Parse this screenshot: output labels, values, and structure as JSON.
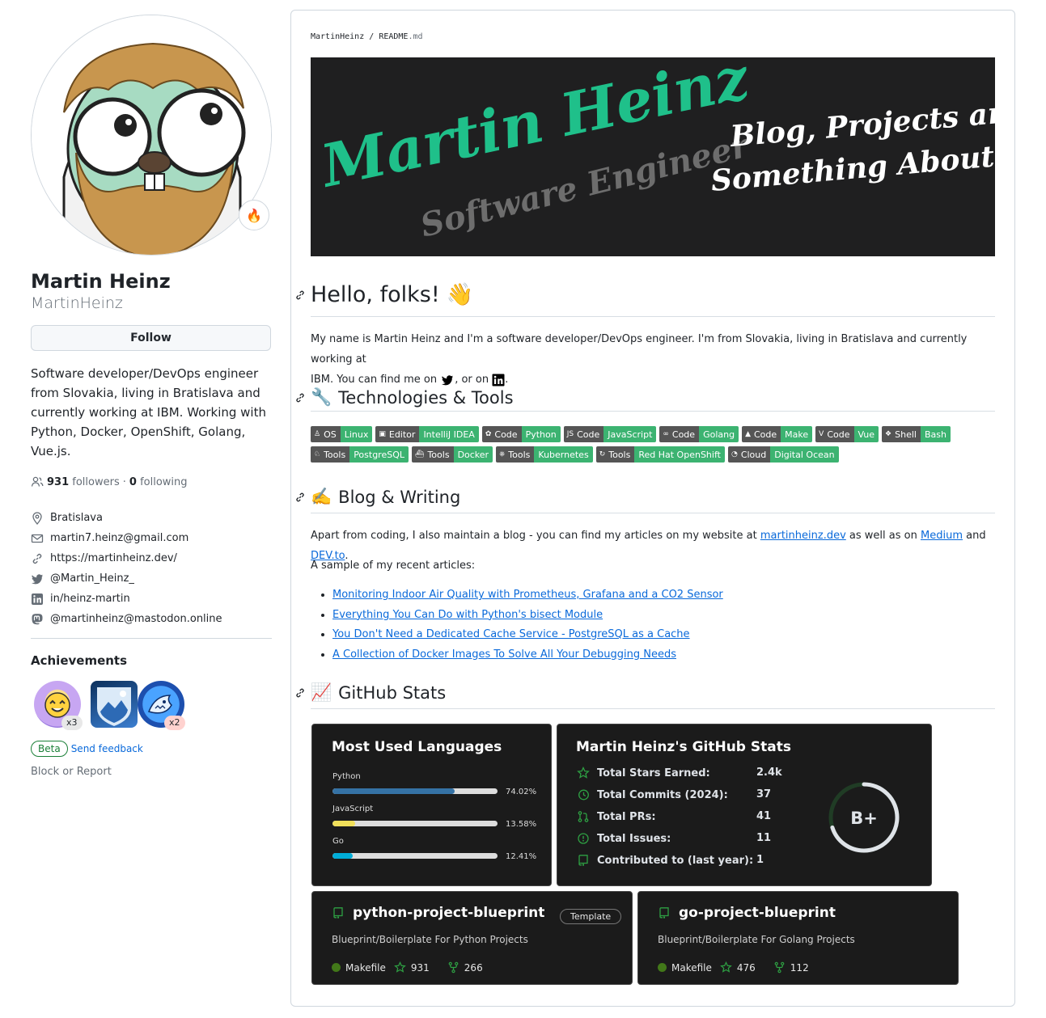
{
  "profile": {
    "fullname": "Martin Heinz",
    "username": "MartinHeinz",
    "follow_label": "Follow",
    "status_emoji": "🔥",
    "bio": "Software developer/DevOps engineer from Slovakia, living in Bratislava and currently working at IBM. Working with Python, Docker, OpenShift, Golang, Vue.js.",
    "followers_count": "931",
    "followers_label": "followers",
    "separator": "·",
    "following_count": "0",
    "following_label": "following",
    "location": "Bratislava",
    "email": "martin7.heinz@gmail.com",
    "website": "https://martinheinz.dev/",
    "twitter": "@Martin_Heinz_",
    "linkedin": "in/heinz-martin",
    "mastodon": "@martinheinz@mastodon.online",
    "achievements_title": "Achievements",
    "achievements": [
      {
        "name": "starstruck-badge",
        "count": "x3"
      },
      {
        "name": "arctic-code-vault-badge",
        "count": ""
      },
      {
        "name": "pull-shark-badge",
        "count": "x2"
      }
    ],
    "beta_label": "Beta",
    "feedback_label": "Send feedback",
    "block_label": "Block or Report"
  },
  "readme": {
    "crumb_user": "MartinHeinz",
    "crumb_sep": "/",
    "crumb_file": "README",
    "crumb_ext": ".md",
    "banner": {
      "name": "Martin Heinz",
      "role": "Software Engineer",
      "tagline_1": "Blog, Projects and",
      "tagline_2": "Something About Me"
    },
    "hello_heading": "Hello, folks!",
    "hello_emoji": "👋",
    "intro_1": "My name is Martin Heinz and I'm a software developer/DevOps engineer. I'm from Slovakia, living in Bratislava and currently working at",
    "intro_2a": "IBM. You can find me on",
    "intro_2b": ", or on",
    "intro_2c": ".",
    "tech_heading": "Technologies & Tools",
    "tech_emoji": "🔧",
    "shields": [
      {
        "label": "OS",
        "value": "Linux"
      },
      {
        "label": "Editor",
        "value": "IntelliJ IDEA"
      },
      {
        "label": "Code",
        "value": "Python"
      },
      {
        "label": "Code",
        "value": "JavaScript"
      },
      {
        "label": "Code",
        "value": "Golang"
      },
      {
        "label": "Code",
        "value": "Make"
      },
      {
        "label": "Code",
        "value": "Vue"
      },
      {
        "label": "Shell",
        "value": "Bash"
      },
      {
        "label": "Tools",
        "value": "PostgreSQL"
      },
      {
        "label": "Tools",
        "value": "Docker"
      },
      {
        "label": "Tools",
        "value": "Kubernetes"
      },
      {
        "label": "Tools",
        "value": "Red Hat OpenShift"
      },
      {
        "label": "Cloud",
        "value": "Digital Ocean"
      }
    ],
    "blog_heading": "Blog & Writing",
    "blog_emoji": "✍️",
    "blog_p1a": "Apart from coding, I also maintain a blog - you can find my articles on my website at",
    "blog_p1_link1": "martinheinz.dev",
    "blog_p1b": "as well as on",
    "blog_p1_link2": "Medium",
    "blog_p1c": "and",
    "blog_p1_link3": "DEV.to",
    "blog_p1d": ".",
    "blog_p2": "A sample of my recent articles:",
    "articles": [
      "Monitoring Indoor Air Quality with Prometheus, Grafana and a CO2 Sensor",
      "Everything You Can Do with Python's bisect Module",
      "You Don't Need a Dedicated Cache Service - PostgreSQL as a Cache",
      "A Collection of Docker Images To Solve All Your Debugging Needs"
    ],
    "stats_heading": "GitHub Stats",
    "stats_emoji": "📈"
  },
  "languages_card": {
    "title": "Most Used Languages",
    "languages": [
      {
        "name": "Python",
        "pct_label": "74.02%",
        "pct": 74.02,
        "color": "#3572A5"
      },
      {
        "name": "JavaScript",
        "pct_label": "13.58%",
        "pct": 13.58,
        "color": "#f1e05a"
      },
      {
        "name": "Go",
        "pct_label": "12.41%",
        "pct": 12.41,
        "color": "#00ADD8"
      }
    ]
  },
  "stats_card": {
    "title": "Martin Heinz's GitHub Stats",
    "rows": [
      {
        "label": "Total Stars Earned:",
        "value": "2.4k",
        "icon": "star-icon"
      },
      {
        "label": "Total Commits (2024):",
        "value": "37",
        "icon": "history-icon"
      },
      {
        "label": "Total PRs:",
        "value": "41",
        "icon": "pull-request-icon"
      },
      {
        "label": "Total Issues:",
        "value": "11",
        "icon": "issue-icon"
      },
      {
        "label": "Contributed to (last year):",
        "value": "1",
        "icon": "repo-icon"
      }
    ],
    "rank": "B+",
    "rank_progress": 0.7,
    "accent": "#2ea043"
  },
  "repo_cards": [
    {
      "name": "python-project-blueprint",
      "badge": "Template",
      "desc": "Blueprint/Boilerplate For Python Projects",
      "language": "Makefile",
      "stars": "931",
      "forks": "266"
    },
    {
      "name": "go-project-blueprint",
      "badge": "",
      "desc": "Blueprint/Boilerplate For Golang Projects",
      "language": "Makefile",
      "stars": "476",
      "forks": "112"
    }
  ],
  "colors": {
    "link": "#0969da",
    "shield_label": "#555555",
    "shield_value": "#3cb371",
    "card_bg": "#1b1b1b",
    "makefile_dot": "#427819"
  }
}
